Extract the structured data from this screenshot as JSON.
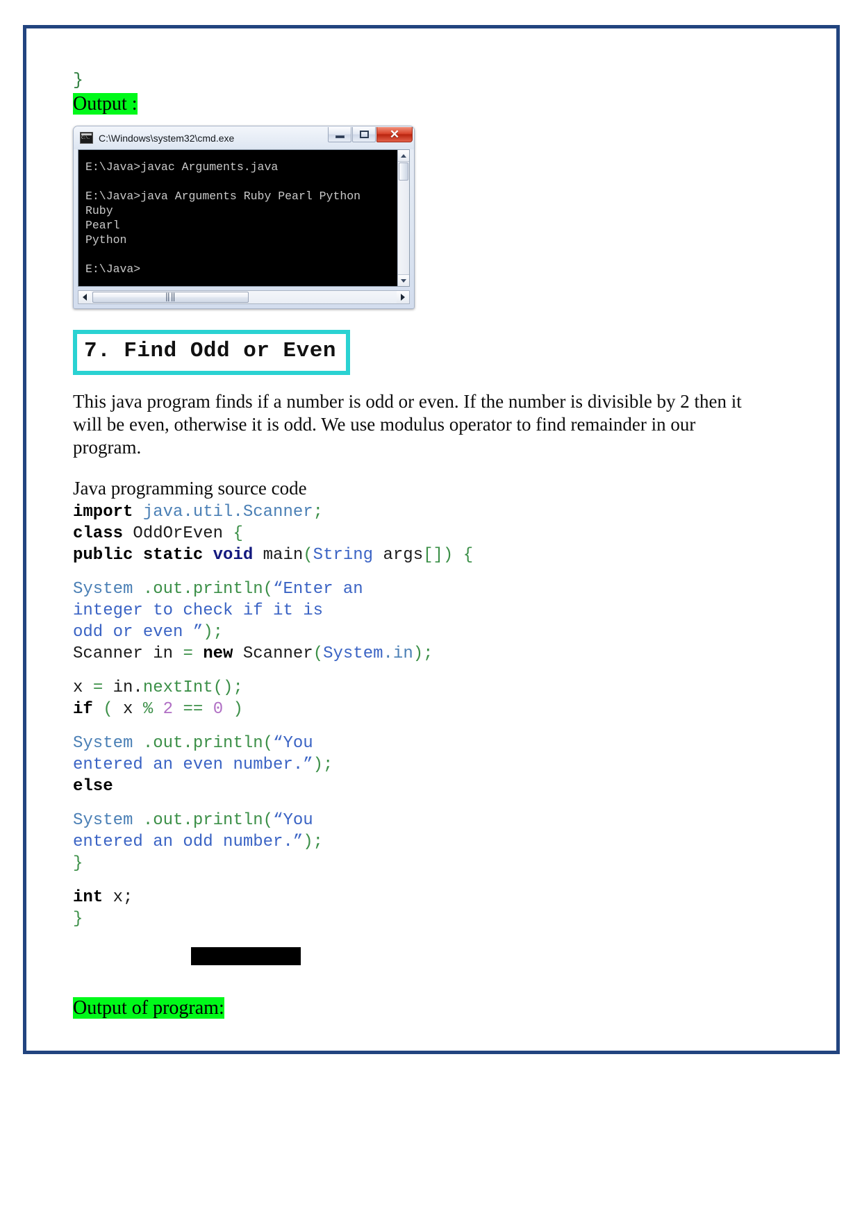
{
  "page": {
    "border_color": "#22447f",
    "highlight_color": "#00f91a",
    "heading_border_color": "#2ad2d2"
  },
  "top_fragment": {
    "closing_brace": "}",
    "output_label": "Output :"
  },
  "cmd_window": {
    "title": "C:\\Windows\\system32\\cmd.exe",
    "icon_name": "cmd-console-icon",
    "icon_text": "C:\\.",
    "buttons": {
      "minimize": "minimize",
      "maximize": "maximize",
      "close": "✕"
    },
    "console_lines": [
      "E:\\Java>javac Arguments.java",
      "",
      "E:\\Java>java Arguments Ruby Pearl Python",
      "Ruby",
      "Pearl",
      "Python",
      "",
      "E:\\Java>"
    ],
    "hscroll_grip": "‖‖",
    "vscroll_up": "scroll-up",
    "vscroll_down": "scroll-down"
  },
  "section": {
    "heading": "7. Find Odd or Even",
    "description": "This java program finds if a number is odd or even. If the number is divisible by 2 then it will be even, otherwise it is odd. We use modulus operator to find remainder in our program.",
    "source_label": "Java programming source code"
  },
  "code": {
    "lines": [
      [
        {
          "text": "import",
          "style": "k-bold"
        },
        {
          "text": " ",
          "style": "t-plain"
        },
        {
          "text": "java.util.Scanner",
          "style": "t-steel"
        },
        {
          "text": ";",
          "style": "t-green"
        }
      ],
      [
        {
          "text": "class",
          "style": "k-bold"
        },
        {
          "text": " OddOrEven ",
          "style": "t-plain"
        },
        {
          "text": "{",
          "style": "t-green"
        }
      ],
      [
        {
          "text": "public static ",
          "style": "k-bold"
        },
        {
          "text": "void",
          "style": "k-navy"
        },
        {
          "text": " main",
          "style": "t-plain"
        },
        {
          "text": "(",
          "style": "t-green"
        },
        {
          "text": "String",
          "style": "t-blue"
        },
        {
          "text": " args",
          "style": "t-plain"
        },
        {
          "text": "[]) {",
          "style": "t-green"
        }
      ],
      [
        {
          "text": "System",
          "style": "t-steel"
        },
        {
          "text": " .out.",
          "style": "t-green"
        },
        {
          "text": "println",
          "style": "t-green"
        },
        {
          "text": "(",
          "style": "t-green"
        },
        {
          "text": "“Enter an",
          "style": "t-blue"
        }
      ],
      [
        {
          "text": "integer to check if it is",
          "style": "t-blue"
        }
      ],
      [
        {
          "text": "odd or even ”",
          "style": "t-blue"
        },
        {
          "text": ");",
          "style": "t-green"
        }
      ],
      [
        {
          "text": "Scanner in ",
          "style": "t-plain"
        },
        {
          "text": "=",
          "style": "t-green"
        },
        {
          "text": " ",
          "style": "t-plain"
        },
        {
          "text": "new",
          "style": "k-bold"
        },
        {
          "text": " Scanner",
          "style": "t-plain"
        },
        {
          "text": "(",
          "style": "t-green"
        },
        {
          "text": "System",
          "style": "t-blue"
        },
        {
          "text": ".in",
          "style": "t-steel"
        },
        {
          "text": ");",
          "style": "t-green"
        }
      ],
      [
        {
          "text": "x ",
          "style": "t-plain"
        },
        {
          "text": "=",
          "style": "t-green"
        },
        {
          "text": " in.",
          "style": "t-plain"
        },
        {
          "text": "nextInt",
          "style": "t-green"
        },
        {
          "text": "();",
          "style": "t-green"
        }
      ],
      [
        {
          "text": "if",
          "style": "k-bold"
        },
        {
          "text": " ( ",
          "style": "t-green"
        },
        {
          "text": "x ",
          "style": "t-plain"
        },
        {
          "text": "%",
          "style": "t-green"
        },
        {
          "text": " ",
          "style": "t-plain"
        },
        {
          "text": "2",
          "style": "t-purple"
        },
        {
          "text": " ",
          "style": "t-plain"
        },
        {
          "text": "==",
          "style": "t-green"
        },
        {
          "text": " ",
          "style": "t-plain"
        },
        {
          "text": "0",
          "style": "t-purple"
        },
        {
          "text": " )",
          "style": "t-green"
        }
      ],
      [
        {
          "text": "System",
          "style": "t-steel"
        },
        {
          "text": " .out.",
          "style": "t-green"
        },
        {
          "text": "println",
          "style": "t-green"
        },
        {
          "text": "(",
          "style": "t-green"
        },
        {
          "text": "“You",
          "style": "t-blue"
        }
      ],
      [
        {
          "text": "entered an even number.”",
          "style": "t-blue"
        },
        {
          "text": ");",
          "style": "t-green"
        }
      ],
      [
        {
          "text": "else",
          "style": "k-bold"
        }
      ],
      [
        {
          "text": "System",
          "style": "t-steel"
        },
        {
          "text": " .out.",
          "style": "t-green"
        },
        {
          "text": "println",
          "style": "t-green"
        },
        {
          "text": "(",
          "style": "t-green"
        },
        {
          "text": "“You",
          "style": "t-blue"
        }
      ],
      [
        {
          "text": "entered an odd number.”",
          "style": "t-blue"
        },
        {
          "text": ");",
          "style": "t-green"
        }
      ],
      [
        {
          "text": "}",
          "style": "t-green"
        }
      ],
      [
        {
          "text": "int",
          "style": "k-bold"
        },
        {
          "text": " x;",
          "style": "t-plain"
        }
      ],
      [
        {
          "text": "}",
          "style": "t-green"
        }
      ]
    ],
    "gap_before": [
      3,
      7,
      9,
      12,
      15
    ]
  },
  "footer": {
    "output_of_program": "Output of program:"
  }
}
